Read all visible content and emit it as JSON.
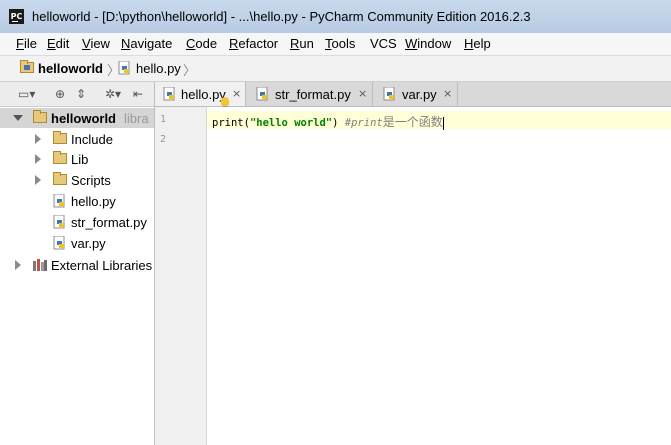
{
  "window": {
    "app_icon_text": "PC",
    "title": "helloworld - [D:\\python\\helloworld] - ...\\hello.py - PyCharm Community Edition 2016.2.3"
  },
  "menu": [
    {
      "accel": "F",
      "rest": "ile"
    },
    {
      "accel": "E",
      "rest": "dit"
    },
    {
      "accel": "V",
      "rest": "iew"
    },
    {
      "accel": "N",
      "rest": "avigate"
    },
    {
      "accel": "C",
      "rest": "ode"
    },
    {
      "accel": "R",
      "rest": "efactor"
    },
    {
      "accel": "R",
      "rest": "un"
    },
    {
      "accel": "T",
      "rest": "ools"
    },
    {
      "accel": "",
      "rest": "VCS"
    },
    {
      "accel": "W",
      "rest": "indow"
    },
    {
      "accel": "H",
      "rest": "elp"
    }
  ],
  "breadcrumb": {
    "project": "helloworld",
    "file": "hello.py"
  },
  "tabs": [
    {
      "label": "hello.py",
      "active": true
    },
    {
      "label": "str_format.py",
      "active": false
    },
    {
      "label": "var.py",
      "active": false
    }
  ],
  "tree": {
    "root": {
      "label": "helloworld",
      "suffix": "libra"
    },
    "children": [
      {
        "label": "Include",
        "type": "folder"
      },
      {
        "label": "Lib",
        "type": "folder"
      },
      {
        "label": "Scripts",
        "type": "folder"
      },
      {
        "label": "hello.py",
        "type": "py"
      },
      {
        "label": "str_format.py",
        "type": "py"
      },
      {
        "label": "var.py",
        "type": "py"
      }
    ],
    "external": "External Libraries"
  },
  "editor": {
    "line_numbers": [
      "1",
      "2"
    ],
    "code": {
      "func": "print",
      "open": "(",
      "string": "\"hello world\"",
      "close": ")",
      "space": " ",
      "comment_prefix": "#",
      "comment_italic": "print",
      "comment_text": "是一个函数"
    }
  },
  "icons": {
    "close": "×"
  },
  "colors": {
    "string": "#008000",
    "comment": "#808080",
    "current_line": "#ffffd7",
    "selection": "#d5d5d5"
  }
}
